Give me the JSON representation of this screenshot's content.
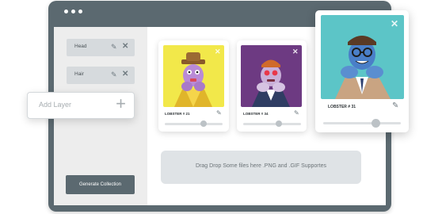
{
  "layers": [
    {
      "label": "Head"
    },
    {
      "label": "Hair"
    }
  ],
  "add_layer": {
    "placeholder": "Add Layer"
  },
  "generate_button": {
    "label": "Generate Collection"
  },
  "cards": [
    {
      "title": "LOBSTER # 21",
      "bg": "#f2e84a",
      "slider": 0.72
    },
    {
      "title": "LOBSTER # 34",
      "bg": "#6d3a82",
      "slider": 0.66
    },
    {
      "title": "LOBSTER # 31",
      "bg": "#5cc5c7",
      "slider": 0.66
    }
  ],
  "dropzone": {
    "text": "Drag Drop Some files here .PNG and .GIF Supportes"
  },
  "colors": {
    "window": "#5b6970",
    "sidebar": "#ededed",
    "layer_item": "#d6dadd",
    "dropzone": "#dfe3e6"
  },
  "icons": {
    "edit": "pencil-icon",
    "remove": "close-icon",
    "add": "plus-icon"
  }
}
